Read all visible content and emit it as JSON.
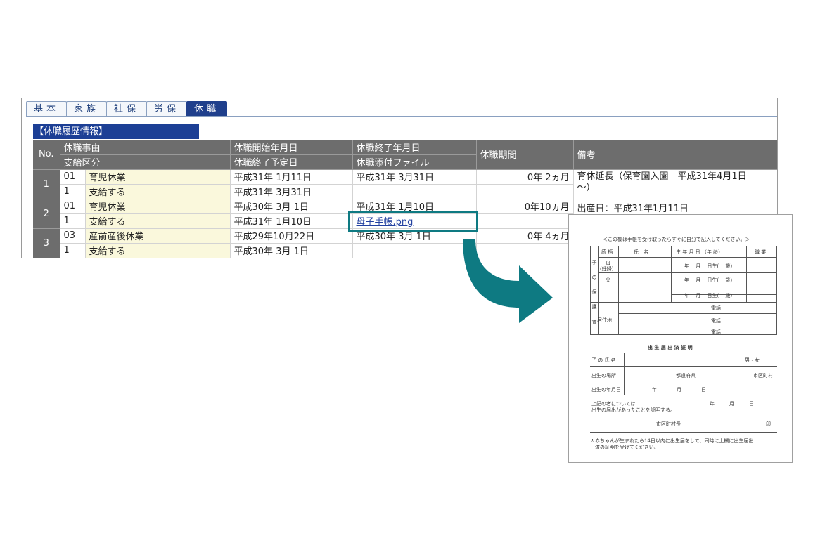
{
  "tabs": [
    {
      "label": "基本",
      "active": false
    },
    {
      "label": "家族",
      "active": false
    },
    {
      "label": "社保",
      "active": false
    },
    {
      "label": "労保",
      "active": false
    },
    {
      "label": "休職",
      "active": true
    }
  ],
  "section_title": "【休職履歴情報】",
  "table": {
    "headers": {
      "no": "No.",
      "reason": "休職事由",
      "pay_type": "支給区分",
      "start_date": "休職開始年月日",
      "planned_end": "休職終了予定日",
      "end_date": "休職終了年月日",
      "attachment": "休職添付ファイル",
      "period": "休職期間",
      "notes": "備考"
    },
    "rows": [
      {
        "no": "1",
        "reason_code": "01",
        "reason": "育児休業",
        "pay_code": "1",
        "pay": "支給する",
        "start": "平成31年 1月11日",
        "planned_end": "平成31年 3月31日",
        "end": "平成31年 3月31日",
        "attachment": "",
        "period": "0年 2ヵ月",
        "notes": "育休延長（保育園入園　平成31年4月1日",
        "notes2": "～）"
      },
      {
        "no": "2",
        "reason_code": "01",
        "reason": "育児休業",
        "pay_code": "1",
        "pay": "支給する",
        "start": "平成30年 3月 1日",
        "planned_end": "平成31年 1月10日",
        "end": "平成31年 1月10日",
        "attachment": "母子手帳.png",
        "period": "0年10ヵ月",
        "notes": "出産日：平成31年1月11日",
        "notes2": ""
      },
      {
        "no": "3",
        "reason_code": "03",
        "reason": "産前産後休業",
        "pay_code": "1",
        "pay": "支給する",
        "start": "平成29年10月22日",
        "planned_end": "平成30年 3月 1日",
        "end": "平成30年 3月 1日",
        "attachment": "",
        "period": "0年 4ヵ月",
        "notes": "",
        "notes2": ""
      }
    ]
  },
  "document": {
    "top_note": "＜この欄は手帳を受け取ったらすぐに自分で記入してください。＞",
    "col_relation": "続 柄",
    "col_name": "氏　名",
    "col_birth": "生 年 月 日 （年 齢）",
    "col_job": "職 業",
    "side_guardian": "子の保護者",
    "mother": "母",
    "mother_note": "(妊婦)",
    "father": "父",
    "birth_fmt": "年　 月　 日生(　 歳)",
    "address": "居住地",
    "phone": "電話",
    "cert_title": "出 生 届 出 済 証 明",
    "child_name": "子 の 氏 名",
    "sex": "男・女",
    "birth_place": "出生の場所",
    "prefecture": "都道府県",
    "city": "市区町村",
    "birth_date": "出生の年月日",
    "ymd": "年　　　　月　　　　日",
    "above_person": "上記の者については",
    "reported": "出生の届出があったことを証明する。",
    "date_fmt": "年　　　月　　　日",
    "mayor": "市区町村長",
    "seal": "印",
    "footer1": "※赤ちゃんが生まれたら14日以内に出生届をして、同時に上欄に出生届出",
    "footer2": "　済の証明を受けてください。"
  },
  "colors": {
    "active_tab": "#1f3f8c",
    "header_gray": "#6d6d6d",
    "cream": "#faf8dc",
    "highlight": "#0e7a82"
  }
}
